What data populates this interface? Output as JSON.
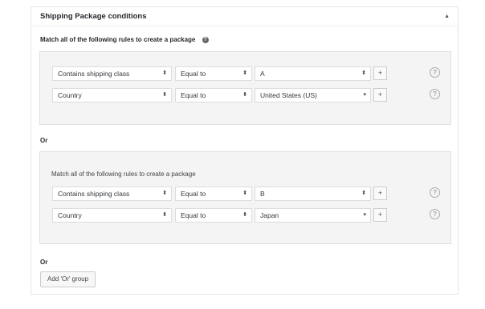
{
  "panel": {
    "title": "Shipping Package conditions",
    "toggle_glyph": "▲",
    "intro": "Match all of the following rules to create a package",
    "help_glyph": "?"
  },
  "groups": [
    {
      "subtitle": "",
      "rows": [
        {
          "condition": "Contains shipping class",
          "operator": "Equal to",
          "value": "A",
          "value_arrow": "⬍"
        },
        {
          "condition": "Country",
          "operator": "Equal to",
          "value": "United States (US)",
          "value_arrow": "▾"
        }
      ]
    },
    {
      "subtitle": "Match all of the following rules to create a package",
      "rows": [
        {
          "condition": "Contains shipping class",
          "operator": "Equal to",
          "value": "B",
          "value_arrow": "⬍"
        },
        {
          "condition": "Country",
          "operator": "Equal to",
          "value": "Japan",
          "value_arrow": "▾"
        }
      ]
    }
  ],
  "or_label": "Or",
  "add_button": "Add 'Or' group",
  "glyphs": {
    "select_arrow": "⬍",
    "plus": "+",
    "question": "?"
  }
}
